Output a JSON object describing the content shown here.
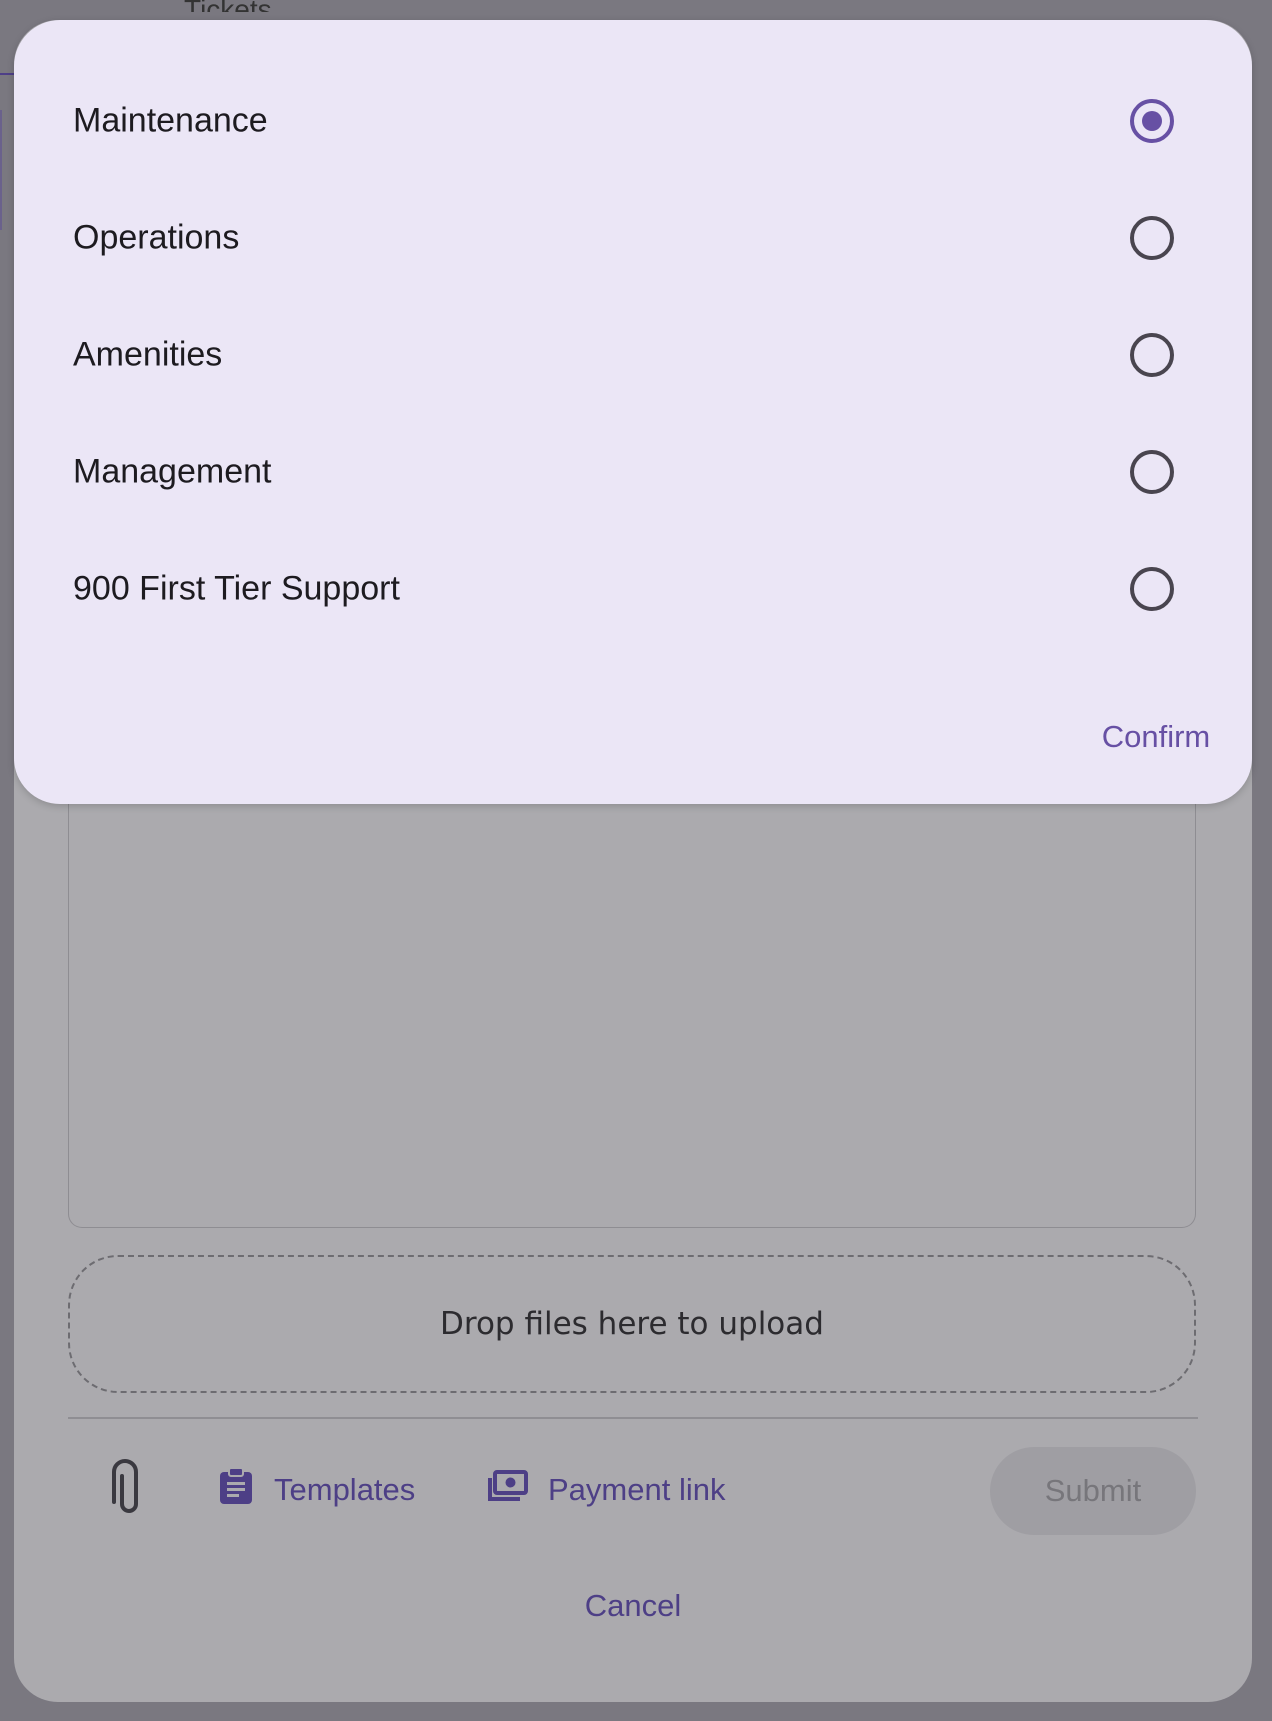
{
  "background": {
    "title": "Tickets"
  },
  "sheet": {
    "dropzone_text": "Drop files here to upload",
    "toolbar": {
      "attach_icon": "paperclip-icon",
      "templates_icon": "clipboard-icon",
      "templates_label": "Templates",
      "payment_icon": "cash-icon",
      "payment_label": "Payment link",
      "submit_label": "Submit"
    },
    "cancel_label": "Cancel"
  },
  "dialog": {
    "options": [
      {
        "label": "Maintenance",
        "selected": true
      },
      {
        "label": "Operations",
        "selected": false
      },
      {
        "label": "Amenities",
        "selected": false
      },
      {
        "label": "Management",
        "selected": false
      },
      {
        "label": "900 First Tier Support",
        "selected": false
      }
    ],
    "confirm_label": "Confirm"
  },
  "colors": {
    "accent": "#6750a4",
    "dialog_bg": "#ebe6f6",
    "scrim": "#7a7880"
  }
}
